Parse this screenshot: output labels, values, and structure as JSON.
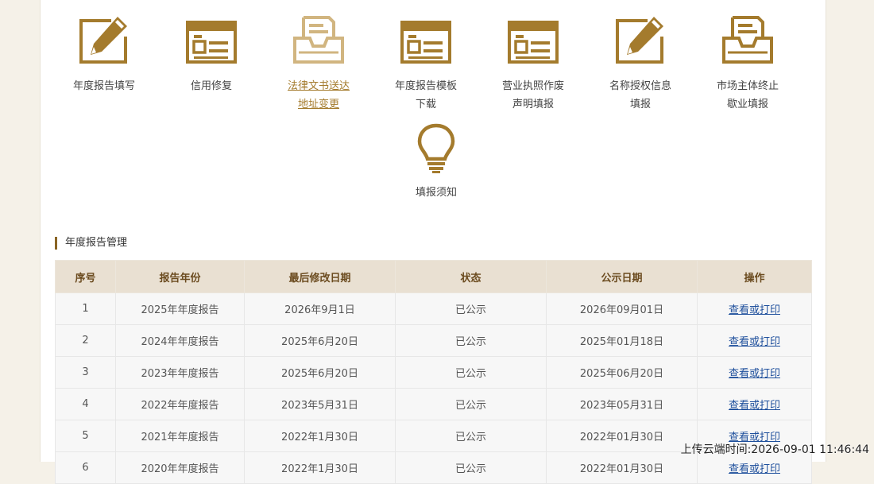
{
  "services": [
    {
      "line1": "年度报告填写",
      "line2": "",
      "icon": "pencil-box-icon"
    },
    {
      "line1": "信用修复",
      "line2": "",
      "icon": "window-form-icon"
    },
    {
      "line1": "法律文书送达",
      "line2": "地址变更",
      "icon": "inbox-tray-icon"
    },
    {
      "line1": "年度报告模板",
      "line2": "下载",
      "icon": "window-form-icon"
    },
    {
      "line1": "营业执照作废",
      "line2": "声明填报",
      "icon": "window-form-icon"
    },
    {
      "line1": "名称授权信息",
      "line2": "填报",
      "icon": "pencil-box-icon"
    },
    {
      "line1": "市场主体终止",
      "line2": "歇业填报",
      "icon": "inbox-tray-icon"
    },
    {
      "line1": "填报须知",
      "line2": "",
      "icon": "lightbulb-icon"
    }
  ],
  "section": {
    "title": "年度报告管理"
  },
  "table": {
    "headers": [
      "序号",
      "报告年份",
      "最后修改日期",
      "状态",
      "公示日期",
      "操作"
    ],
    "rows": [
      [
        "1",
        "2025年年度报告",
        "2026年9月1日",
        "已公示",
        "2026年09月01日",
        "查看或打印"
      ],
      [
        "2",
        "2024年年度报告",
        "2025年6月20日",
        "已公示",
        "2025年01月18日",
        "查看或打印"
      ],
      [
        "3",
        "2023年年度报告",
        "2025年6月20日",
        "已公示",
        "2025年06月20日",
        "查看或打印"
      ],
      [
        "4",
        "2022年年度报告",
        "2023年5月31日",
        "已公示",
        "2023年05月31日",
        "查看或打印"
      ],
      [
        "5",
        "2021年年度报告",
        "2022年1月30日",
        "已公示",
        "2022年01月30日",
        "查看或打印"
      ],
      [
        "6",
        "2020年年度报告",
        "2022年1月30日",
        "已公示",
        "2022年01月30日",
        "查看或打印"
      ]
    ]
  },
  "timestamp": "上传云端时间:2026-09-01 11:46:44",
  "colors": {
    "icon_gold": "#a47b2d",
    "header_bg": "#e9e0d2",
    "link_blue": "#1e4f9c"
  }
}
